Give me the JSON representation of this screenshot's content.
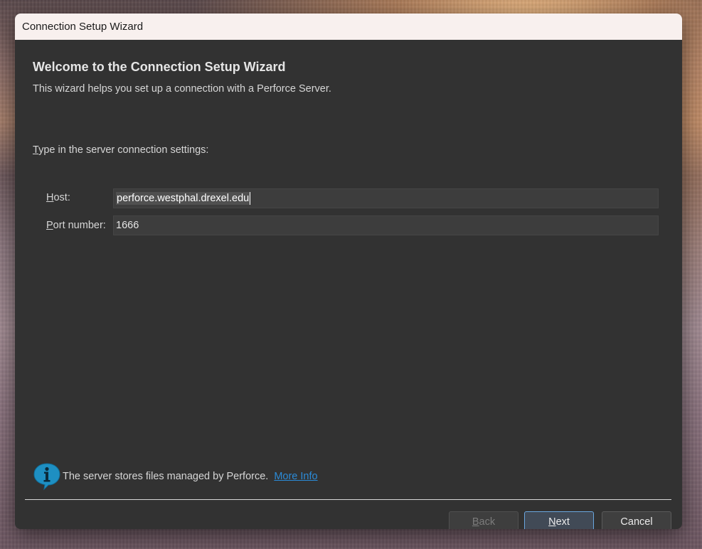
{
  "window": {
    "title": "Connection Setup Wizard"
  },
  "header": {
    "title": "Welcome to the Connection Setup Wizard",
    "description": "This wizard helps you set up a connection with a Perforce Server."
  },
  "form": {
    "section_label_mnemonic": "T",
    "section_label_rest": "ype in the server connection settings:",
    "host_label_mnemonic": "H",
    "host_label_rest": "ost:",
    "host_value": "perforce.westphal.drexel.edu",
    "port_label_mnemonic": "P",
    "port_label_rest": "ort number:",
    "port_value": "1666"
  },
  "info": {
    "icon": "info-icon",
    "text": "The server stores files managed by Perforce.",
    "link": "More Info"
  },
  "buttons": {
    "back_mnemonic": "B",
    "back_rest": "ack",
    "next_mnemonic": "N",
    "next_rest": "ext",
    "cancel": "Cancel"
  },
  "colors": {
    "accent": "#2b8bd8",
    "focus_border": "#6aa7e0",
    "info_icon": "#1e8fc2"
  }
}
